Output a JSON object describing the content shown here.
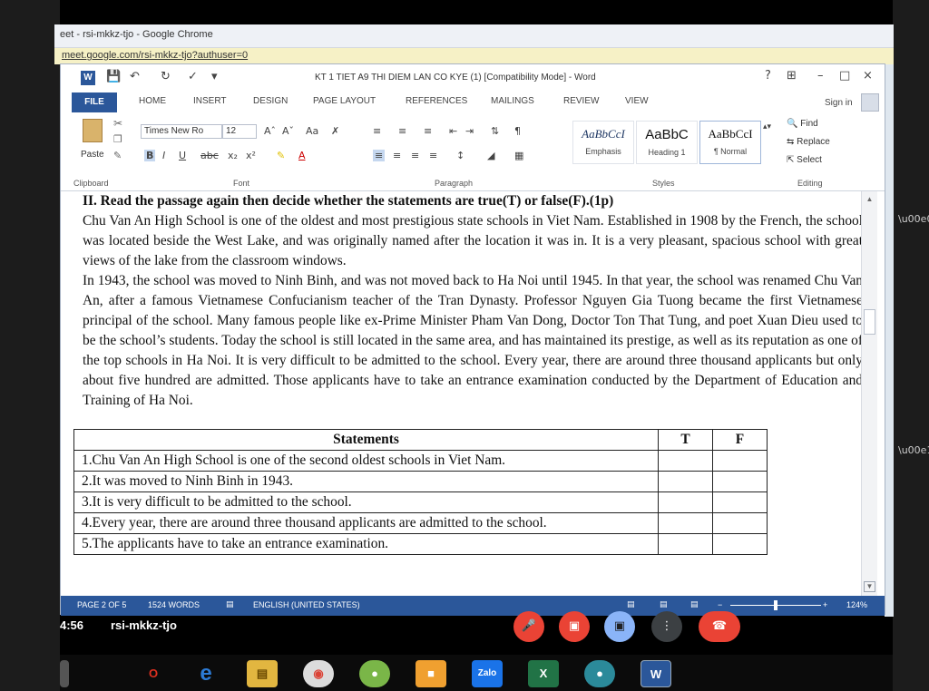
{
  "browser": {
    "title": "eet - rsi-mkkz-tjo - Google Chrome",
    "address": "meet.google.com/rsi-mkkz-tjo?authuser=0"
  },
  "word": {
    "doc_title": "KT 1 TIET A9 THI DIEM LAN CO KYE (1) [Compatibility Mode] - Word",
    "window_controls": [
      "?",
      "⊞",
      "–",
      "□",
      "×"
    ],
    "tabs": [
      "FILE",
      "HOME",
      "INSERT",
      "DESIGN",
      "PAGE LAYOUT",
      "REFERENCES",
      "MAILINGS",
      "REVIEW",
      "VIEW"
    ],
    "sign_in": "Sign in",
    "ribbon": {
      "paste_label": "Paste",
      "font_name": "Times New Ro",
      "font_size": "12",
      "styles": [
        {
          "preview": "AaBbCcI",
          "name": "Emphasis"
        },
        {
          "preview": "AaBbC",
          "name": "Heading 1"
        },
        {
          "preview": "AaBbCcI",
          "name": "¶ Normal"
        }
      ],
      "editing": [
        "Find",
        "Replace",
        "Select"
      ],
      "groups": [
        "Clipboard",
        "Font",
        "Paragraph",
        "Styles",
        "Editing"
      ]
    }
  },
  "document": {
    "heading": "II. Read the passage again then decide whether the statements are true(T) or false(F).(1p)",
    "paragraph1": "Chu Van An High School is one of the oldest and most prestigious state schools in Viet Nam. Established in 1908 by the French, the school was located beside the West Lake, and was originally named after the location it was in. It is a very pleasant, spacious school with great views of the lake from the classroom windows.",
    "paragraph2": "In 1943, the school was moved to Ninh Binh, and was not moved back to Ha Noi until 1945. In that year, the school was renamed Chu Van An, after a famous Vietnamese Confucianism teacher of the Tran Dynasty. Professor Nguyen Gia Tuong became the first Vietnamese principal of the school. Many famous people like ex-Prime Minister Pham Van Dong, Doctor Ton That Tung, and poet Xuan Dieu used to be the school’s students. Today the school is still located in the same area, and has maintained its prestige, as well as its reputation as one of the top schools in Ha Noi. It is very difficult to be admitted to the school. Every year, there are around three thousand applicants but only about five hundred are admitted. Those applicants have to take an entrance examination conducted by the Department of Education and Training of Ha Noi.",
    "table": {
      "headers": [
        "Statements",
        "T",
        "F"
      ],
      "rows": [
        "1.Chu Van An High School is one of the second  oldest schools in Viet Nam.",
        "2.It was moved to Ninh Binh in 1943.",
        "3.It is very difficult to be admitted to the school.",
        "4.Every year, there are around three thousand applicants are admitted to the school.",
        "5.The applicants have to take an entrance examination."
      ]
    }
  },
  "status": {
    "page": "PAGE 2 OF 5",
    "words": "1524 WORDS",
    "language": "ENGLISH (UNITED STATES)",
    "zoom": "124%"
  },
  "meet": {
    "time": "4:56",
    "code": "rsi-mkkz-tjo"
  },
  "colors": {
    "word_blue": "#2b579a",
    "meet_red": "#ea4335",
    "meet_blue": "#8ab4f8"
  }
}
